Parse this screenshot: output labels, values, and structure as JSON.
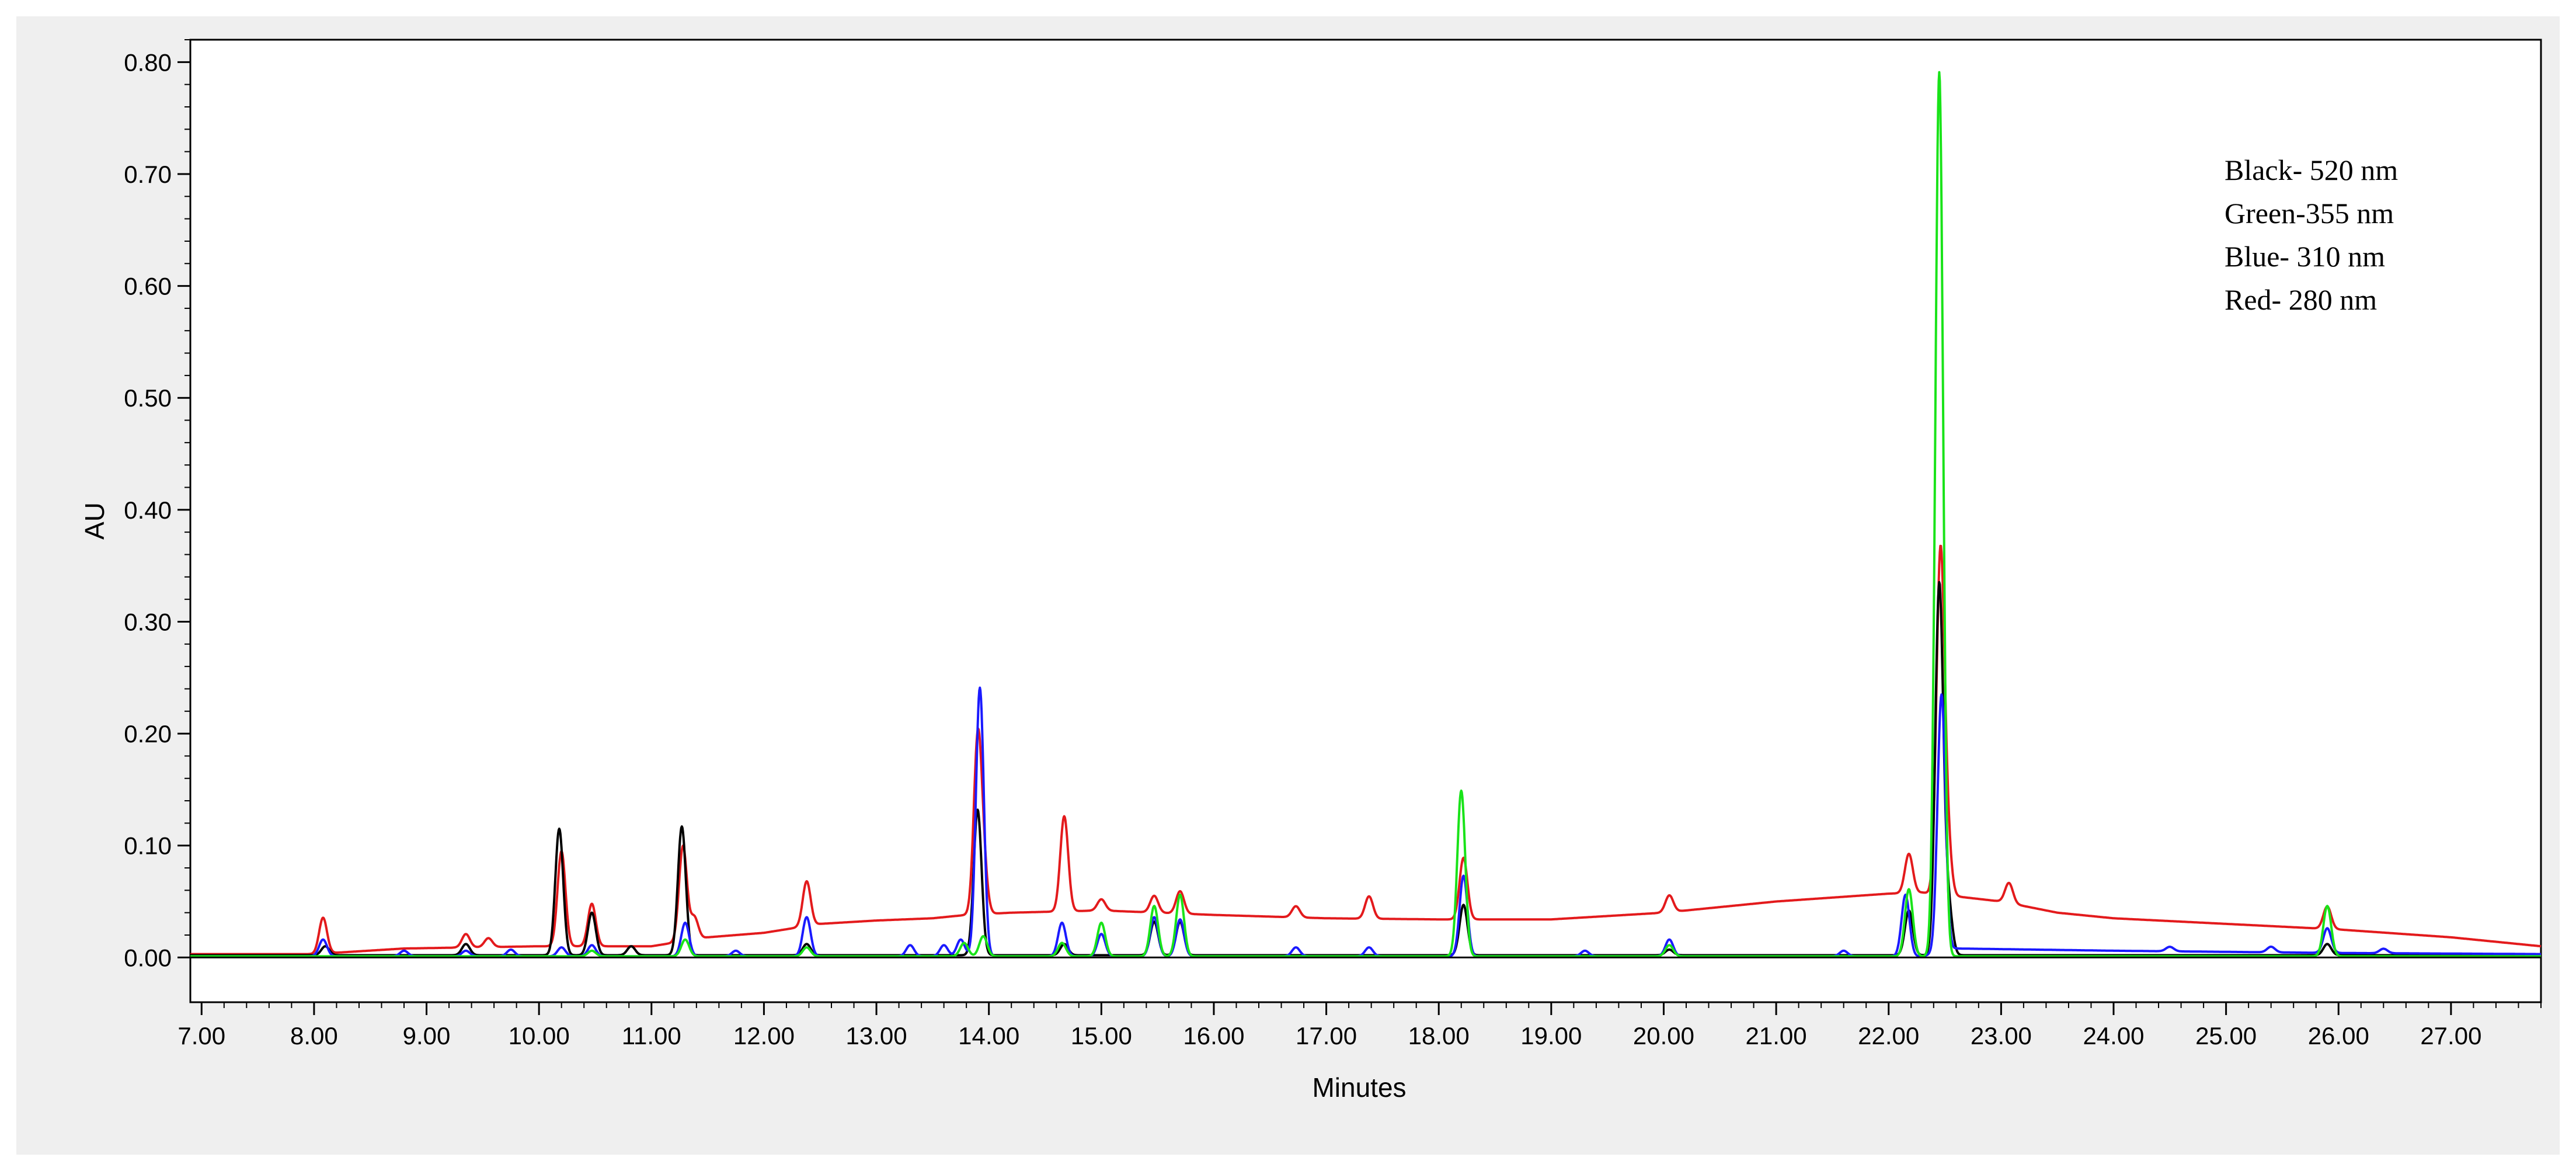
{
  "chart_data": {
    "type": "line",
    "title": "",
    "xlabel": "Minutes",
    "ylabel": "AU",
    "xlim": [
      6.9,
      27.8
    ],
    "ylim": [
      -0.04,
      0.82
    ],
    "x_ticks": [
      "7.00",
      "8.00",
      "9.00",
      "10.00",
      "11.00",
      "12.00",
      "13.00",
      "14.00",
      "15.00",
      "16.00",
      "17.00",
      "18.00",
      "19.00",
      "20.00",
      "21.00",
      "22.00",
      "23.00",
      "24.00",
      "25.00",
      "26.00",
      "27.00"
    ],
    "x_tick_values": [
      7,
      8,
      9,
      10,
      11,
      12,
      13,
      14,
      15,
      16,
      17,
      18,
      19,
      20,
      21,
      22,
      23,
      24,
      25,
      26,
      27
    ],
    "y_ticks": [
      "0.00",
      "0.10",
      "0.20",
      "0.30",
      "0.40",
      "0.50",
      "0.60",
      "0.70",
      "0.80"
    ],
    "y_tick_values": [
      0,
      0.1,
      0.2,
      0.3,
      0.4,
      0.5,
      0.6,
      0.7,
      0.8
    ],
    "grid": false,
    "legend_position": "top-right",
    "legend_lines": [
      "Black- 520 nm",
      "Green-355 nm",
      "Blue- 310 nm",
      "Red- 280 nm"
    ],
    "series": [
      {
        "color": "#e31a1c",
        "baseline": [
          [
            6.9,
            0.003
          ],
          [
            8.0,
            0.003
          ],
          [
            8.8,
            0.008
          ],
          [
            10.0,
            0.01
          ],
          [
            11.0,
            0.01
          ],
          [
            11.5,
            0.018
          ],
          [
            12.0,
            0.022
          ],
          [
            12.5,
            0.03
          ],
          [
            13.0,
            0.033
          ],
          [
            13.5,
            0.035
          ],
          [
            13.8,
            0.038
          ],
          [
            14.2,
            0.04
          ],
          [
            15.0,
            0.042
          ],
          [
            16.0,
            0.038
          ],
          [
            17.0,
            0.035
          ],
          [
            18.0,
            0.034
          ],
          [
            19.0,
            0.034
          ],
          [
            20.0,
            0.04
          ],
          [
            21.0,
            0.05
          ],
          [
            22.0,
            0.057
          ],
          [
            22.3,
            0.058
          ],
          [
            23.0,
            0.05
          ],
          [
            23.5,
            0.04
          ],
          [
            24.0,
            0.035
          ],
          [
            25.0,
            0.03
          ],
          [
            26.0,
            0.025
          ],
          [
            27.0,
            0.018
          ],
          [
            27.8,
            0.01
          ]
        ],
        "peaks": [
          [
            8.08,
            0.032
          ],
          [
            9.35,
            0.012
          ],
          [
            9.55,
            0.008
          ],
          [
            10.2,
            0.085
          ],
          [
            10.47,
            0.038
          ],
          [
            11.28,
            0.085
          ],
          [
            11.38,
            0.02
          ],
          [
            12.38,
            0.04
          ],
          [
            13.9,
            0.15
          ],
          [
            13.95,
            0.04
          ],
          [
            14.67,
            0.085
          ],
          [
            15.0,
            0.01
          ],
          [
            15.47,
            0.015
          ],
          [
            15.7,
            0.02
          ],
          [
            16.73,
            0.01
          ],
          [
            17.38,
            0.02
          ],
          [
            18.22,
            0.055
          ],
          [
            20.05,
            0.015
          ],
          [
            22.18,
            0.035
          ],
          [
            22.46,
            0.3
          ],
          [
            22.52,
            0.05
          ],
          [
            23.07,
            0.018
          ],
          [
            25.9,
            0.02
          ]
        ]
      },
      {
        "color": "#000000",
        "baseline": [
          [
            6.9,
            0.002
          ],
          [
            27.8,
            0.002
          ]
        ],
        "peaks": [
          [
            8.1,
            0.008
          ],
          [
            9.35,
            0.01
          ],
          [
            10.18,
            0.113
          ],
          [
            10.47,
            0.038
          ],
          [
            10.82,
            0.008
          ],
          [
            11.27,
            0.115
          ],
          [
            12.38,
            0.01
          ],
          [
            13.9,
            0.13
          ],
          [
            14.67,
            0.01
          ],
          [
            15.47,
            0.03
          ],
          [
            15.7,
            0.03
          ],
          [
            18.22,
            0.045
          ],
          [
            20.05,
            0.005
          ],
          [
            22.18,
            0.04
          ],
          [
            22.45,
            0.33
          ],
          [
            22.53,
            0.045
          ],
          [
            25.9,
            0.01
          ]
        ]
      },
      {
        "color": "#1a1aff",
        "baseline": [
          [
            6.9,
            0.001
          ],
          [
            22.3,
            0.001
          ],
          [
            22.6,
            0.008
          ],
          [
            24.0,
            0.006
          ],
          [
            25.0,
            0.005
          ],
          [
            26.0,
            0.004
          ],
          [
            27.8,
            0.003
          ]
        ],
        "peaks": [
          [
            8.08,
            0.015
          ],
          [
            8.8,
            0.005
          ],
          [
            9.35,
            0.005
          ],
          [
            9.75,
            0.006
          ],
          [
            10.2,
            0.008
          ],
          [
            10.47,
            0.01
          ],
          [
            11.3,
            0.03
          ],
          [
            11.75,
            0.005
          ],
          [
            12.38,
            0.035
          ],
          [
            13.3,
            0.01
          ],
          [
            13.6,
            0.01
          ],
          [
            13.75,
            0.015
          ],
          [
            13.92,
            0.24
          ],
          [
            14.65,
            0.03
          ],
          [
            15.0,
            0.02
          ],
          [
            15.47,
            0.035
          ],
          [
            15.7,
            0.033
          ],
          [
            16.73,
            0.008
          ],
          [
            17.38,
            0.008
          ],
          [
            18.22,
            0.072
          ],
          [
            19.3,
            0.005
          ],
          [
            20.05,
            0.015
          ],
          [
            21.6,
            0.005
          ],
          [
            22.15,
            0.055
          ],
          [
            22.47,
            0.23
          ],
          [
            24.5,
            0.004
          ],
          [
            25.4,
            0.005
          ],
          [
            25.9,
            0.022
          ],
          [
            26.4,
            0.004
          ]
        ]
      },
      {
        "color": "#19e319",
        "baseline": [
          [
            6.9,
            0.001
          ],
          [
            27.8,
            0.001
          ]
        ],
        "peaks": [
          [
            10.47,
            0.005
          ],
          [
            11.3,
            0.015
          ],
          [
            12.38,
            0.008
          ],
          [
            13.78,
            0.012
          ],
          [
            13.95,
            0.018
          ],
          [
            14.65,
            0.012
          ],
          [
            15.0,
            0.03
          ],
          [
            15.47,
            0.045
          ],
          [
            15.7,
            0.055
          ],
          [
            18.2,
            0.148
          ],
          [
            20.05,
            0.01
          ],
          [
            22.18,
            0.06
          ],
          [
            22.45,
            0.79
          ],
          [
            25.9,
            0.045
          ]
        ]
      }
    ]
  }
}
